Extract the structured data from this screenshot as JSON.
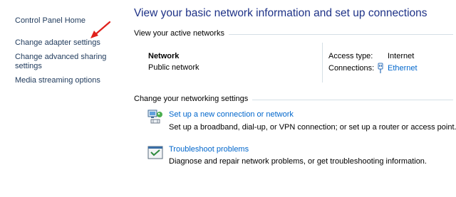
{
  "sidebar": {
    "items": [
      {
        "label": "Control Panel Home"
      },
      {
        "label": "Change adapter settings"
      },
      {
        "label": "Change advanced sharing"
      },
      {
        "label": "settings"
      },
      {
        "label": "Media streaming options"
      }
    ]
  },
  "main": {
    "title": "View your basic network information and set up connections",
    "active_networks": {
      "heading": "View your active networks",
      "network_name": "Network",
      "network_type": "Public network",
      "access_type_label": "Access type:",
      "access_type_value": "Internet",
      "connections_label": "Connections:",
      "connections_value": "Ethernet"
    },
    "settings": {
      "heading": "Change your networking settings",
      "tasks": [
        {
          "link": "Set up a new connection or network",
          "description": "Set up a broadband, dial-up, or VPN connection; or set up a router or access point.",
          "icon": "network-setup-icon"
        },
        {
          "link": "Troubleshoot problems",
          "description": "Diagnose and repair network problems, or get troubleshooting information.",
          "icon": "troubleshoot-icon"
        }
      ]
    }
  },
  "colors": {
    "title": "#1e3287",
    "sidebar_link": "#1e395b",
    "link": "#0066cc",
    "annotation_arrow": "#e0201b"
  }
}
